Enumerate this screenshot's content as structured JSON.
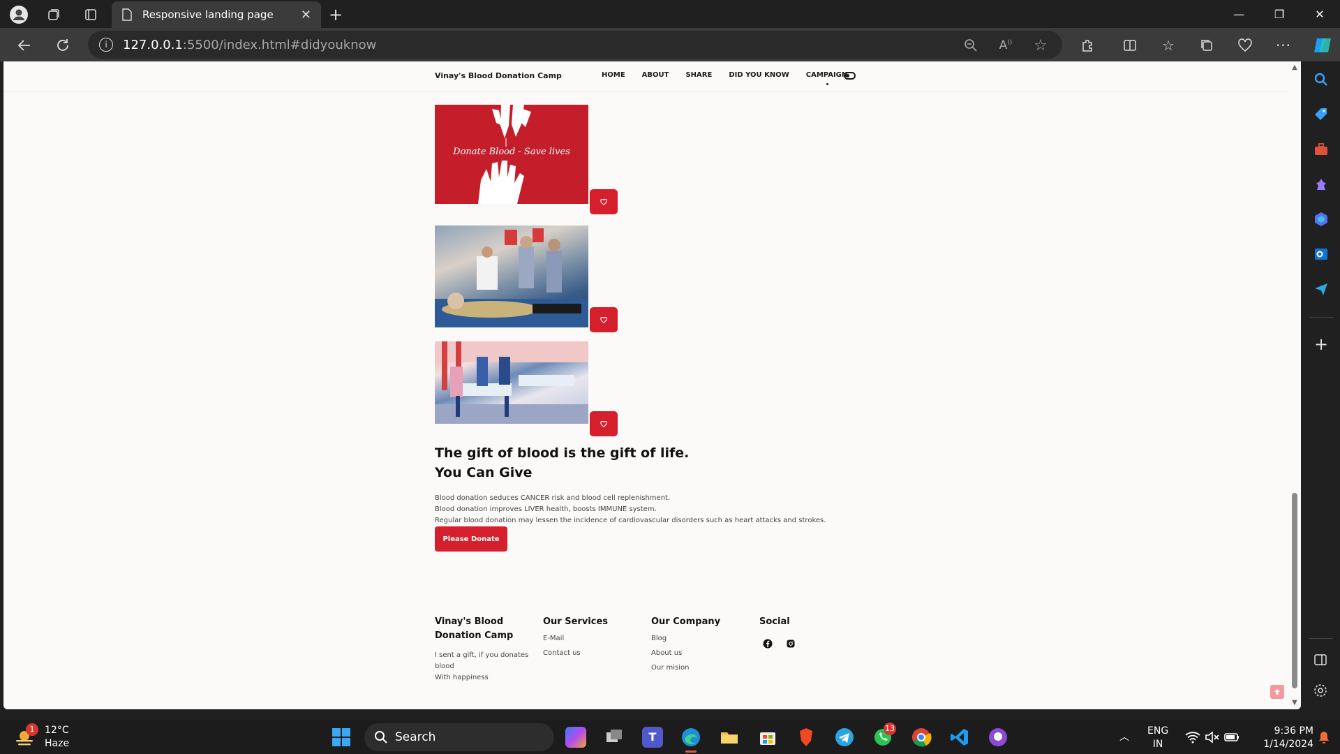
{
  "browser": {
    "tab_title": "Responsive landing page",
    "address_host": "127.0.0.1",
    "address_path": ":5500/index.html#didyouknow"
  },
  "site": {
    "brand": "Vinay's Blood Donation Camp",
    "nav": [
      "HOME",
      "ABOUT",
      "SHARE",
      "DID YOU KNOW",
      "CAMPAIGN"
    ],
    "active_nav": "CAMPAIGN",
    "poster_text": "Donate Blood - Save lives",
    "headline1": "The gift of blood is the gift of life.",
    "headline2": "You Can Give",
    "paragraphs": [
      "Blood donation seduces CANCER risk and blood cell replenishment.",
      "Blood donation improves LIVER health, boosts IMMUNE system.",
      "Regular blood donation may lessen the incidence of cardiovascular disorders such as heart attacks and strokes."
    ],
    "cta_label": "Please Donate"
  },
  "footer": {
    "col1_title": "Vinay's Blood Donation Camp",
    "col1_text": [
      "I sent a gift, if you donates blood",
      "With happiness"
    ],
    "col2_title": "Our Services",
    "col2_links": [
      "E-Mail",
      "Contact us"
    ],
    "col3_title": "Our Company",
    "col3_links": [
      "Blog",
      "About us",
      "Our mision"
    ],
    "col4_title": "Social"
  },
  "taskbar": {
    "temp": "12°C",
    "weather": "Haze",
    "weather_badge": "1",
    "search_placeholder": "Search",
    "whatsapp_badge": "13",
    "lang1": "ENG",
    "lang2": "IN",
    "time": "9:36 PM",
    "date": "1/14/2024"
  },
  "colors": {
    "accent": "#d61f2d",
    "page_bg": "#fcfaf9"
  }
}
